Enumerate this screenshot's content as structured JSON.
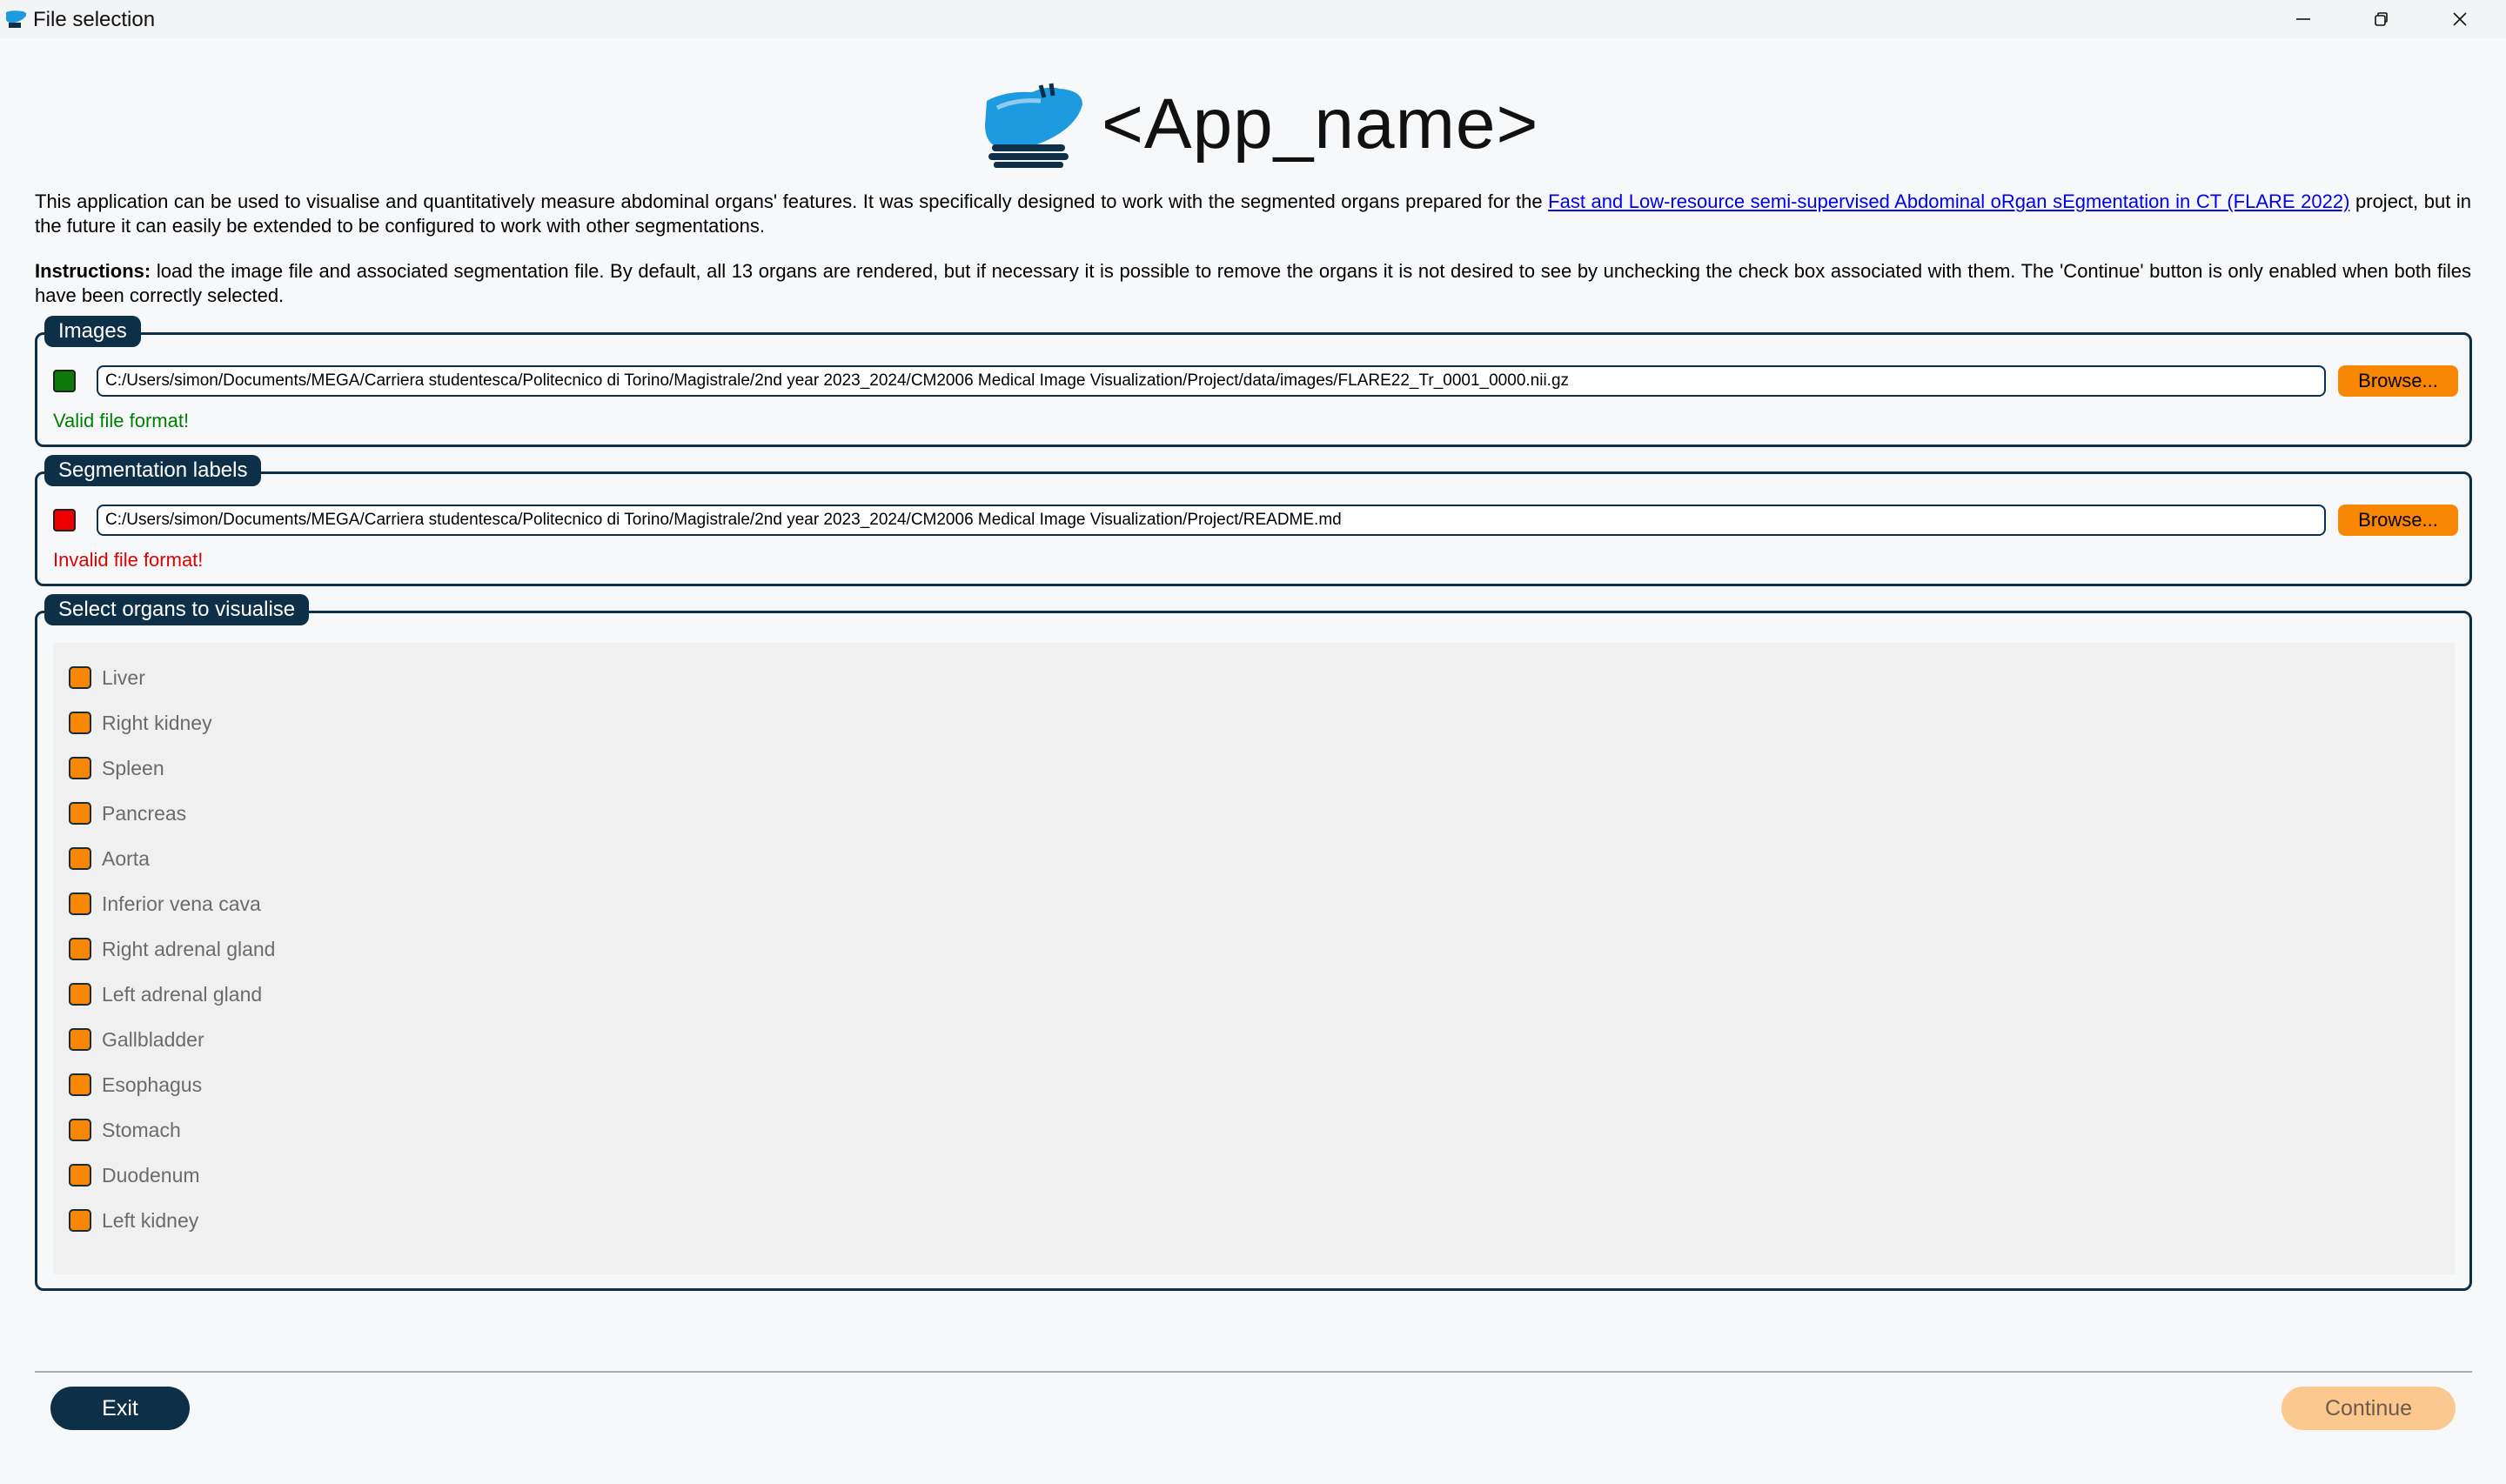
{
  "window": {
    "title": "File selection",
    "icon": "liver-app-icon"
  },
  "header": {
    "app_name": "<App_name>",
    "logo": "liver-logo"
  },
  "description": {
    "text_before_link": "This application can be used to visualise and quantitatively measure abdominal organs' features. It was specifically designed to work with the segmented organs prepared for the ",
    "link_text": "Fast and Low-resource semi-supervised Abdominal oRgan sEgmentation in CT (FLARE 2022)",
    "text_after_link": " project, but in the future it can easily be extended to be configured to work with other segmentations."
  },
  "instructions": {
    "label": "Instructions:",
    "text": " load the image file and associated segmentation file. By default, all 13 organs are rendered, but if necessary it is possible to remove the organs it is not desired to see by unchecking the check box associated with them. The 'Continue' button is only enabled when both files have been correctly selected."
  },
  "images_group": {
    "title": "Images",
    "path": "C:/Users/simon/Documents/MEGA/Carriera studentesca/Politecnico di Torino/Magistrale/2nd year 2023_2024/CM2006 Medical Image Visualization/Project/data/images/FLARE22_Tr_0001_0000.nii.gz",
    "browse_label": "Browse...",
    "status": "Valid file format!",
    "status_color": "#008000"
  },
  "segmentation_group": {
    "title": "Segmentation labels",
    "path": "C:/Users/simon/Documents/MEGA/Carriera studentesca/Politecnico di Torino/Magistrale/2nd year 2023_2024/CM2006 Medical Image Visualization/Project/README.md",
    "browse_label": "Browse...",
    "status": "Invalid file format!",
    "status_color": "#e00000"
  },
  "organs_group": {
    "title": "Select organs to visualise",
    "organs": [
      {
        "label": "Liver",
        "checked": true
      },
      {
        "label": "Right kidney",
        "checked": true
      },
      {
        "label": "Spleen",
        "checked": true
      },
      {
        "label": "Pancreas",
        "checked": true
      },
      {
        "label": "Aorta",
        "checked": true
      },
      {
        "label": "Inferior vena cava",
        "checked": true
      },
      {
        "label": "Right adrenal gland",
        "checked": true
      },
      {
        "label": "Left adrenal gland",
        "checked": true
      },
      {
        "label": "Gallbladder",
        "checked": true
      },
      {
        "label": "Esophagus",
        "checked": true
      },
      {
        "label": "Stomach",
        "checked": true
      },
      {
        "label": "Duodenum",
        "checked": true
      },
      {
        "label": "Left kidney",
        "checked": true
      }
    ]
  },
  "footer": {
    "exit_label": "Exit",
    "continue_label": "Continue",
    "continue_enabled": false
  },
  "colors": {
    "accent_dark": "#0d3048",
    "accent_orange": "#f98706",
    "valid_green": "#008000",
    "invalid_red": "#e00000"
  }
}
